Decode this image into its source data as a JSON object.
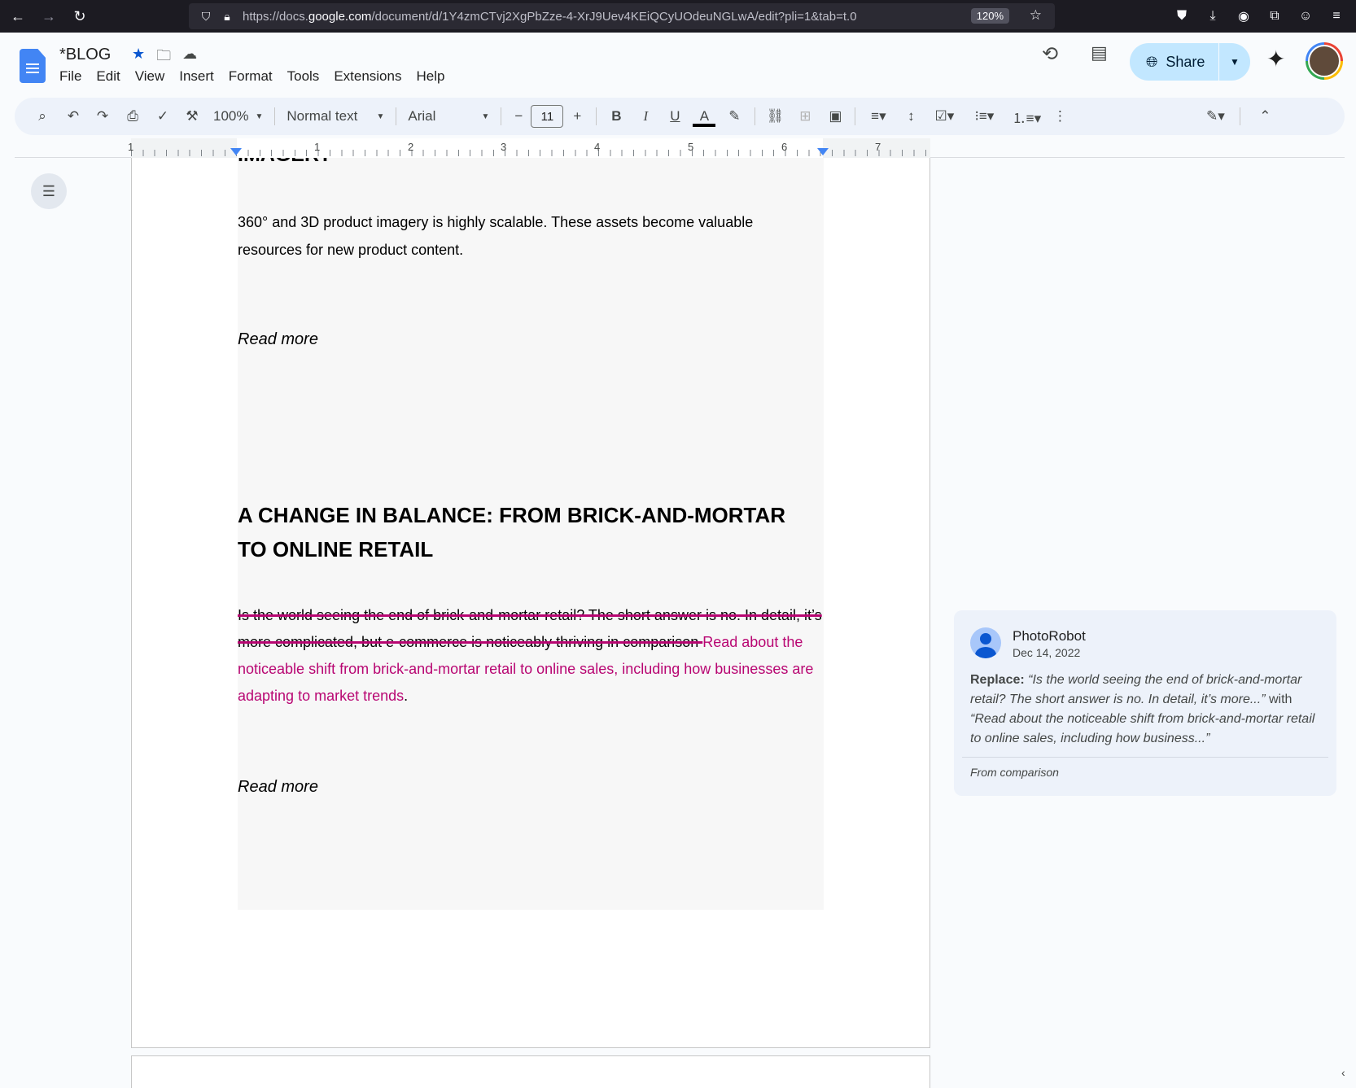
{
  "browser": {
    "url_prefix": "https://docs.",
    "url_domain": "google.com",
    "url_path": "/document/d/1Y4zmCTvj2XgPbZze-4-XrJ9Uev4KEiQCyUOdeuNGLwA/edit?pli=1&tab=t.0",
    "zoom": "120%"
  },
  "docs": {
    "title": "*BLOG",
    "menu": [
      "File",
      "Edit",
      "View",
      "Insert",
      "Format",
      "Tools",
      "Extensions",
      "Help"
    ],
    "share_label": "Share"
  },
  "toolbar": {
    "zoom": "100%",
    "style": "Normal text",
    "font": "Arial",
    "font_size": "11"
  },
  "ruler": {
    "numbers": [
      "1",
      "1",
      "2",
      "3",
      "4",
      "5",
      "6",
      "7"
    ]
  },
  "document": {
    "cut_heading": "IMAGERY",
    "para1": "360° and 3D product imagery is highly scalable. These assets become valuable resources for new product content.",
    "read_more_1": "Read more",
    "heading2": "A CHANGE IN BALANCE: FROM BRICK-AND-MORTAR TO ONLINE RETAIL",
    "deleted_text": "Is the world seeing the end of brick-and-mortar retail? The short answer is no. In detail, it’s more complicated, but e-commerce is noticeably thriving in comparison ",
    "inserted_text": "Read about the noticeable shift from brick-and-mortar retail to online sales, including how businesses are adapting to market trends",
    "trailing": ".",
    "read_more_2": "Read more"
  },
  "comment": {
    "author": "PhotoRobot",
    "date": "Dec 14, 2022",
    "replace_label": "Replace:",
    "old_text": "“Is the world seeing the end of brick-and-mortar retail? The short answer is no. In detail, it’s more...”",
    "with_word": "with",
    "new_text": "“Read about the noticeable shift from brick-and-mortar retail to online sales, including how business...”",
    "source": "From comparison"
  }
}
